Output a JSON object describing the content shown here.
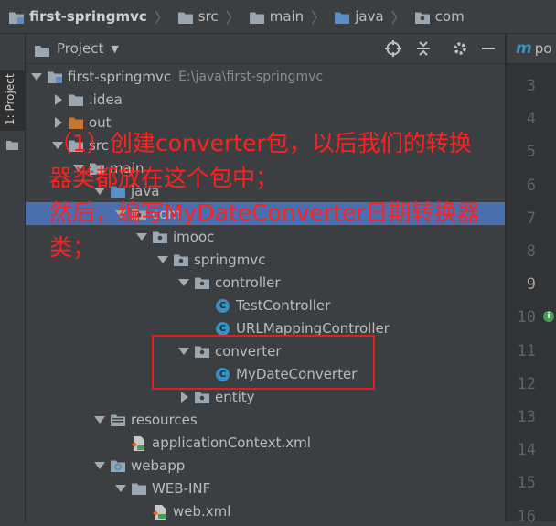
{
  "breadcrumb": [
    "first-springmvc",
    "src",
    "main",
    "java",
    "com"
  ],
  "tool_stripe": {
    "project_tab_label": "1: Project"
  },
  "panel": {
    "title": "Project",
    "caret": "▼"
  },
  "tree": [
    {
      "label": "first-springmvc",
      "path": "E:\\java\\first-springmvc",
      "icon": "module-folder-icon",
      "arrow": "down",
      "indent": 0
    },
    {
      "label": ".idea",
      "icon": "folder-icon",
      "arrow": "right",
      "indent": 1
    },
    {
      "label": "out",
      "icon": "orange-folder-icon",
      "arrow": "right",
      "indent": 1
    },
    {
      "label": "src",
      "icon": "folder-icon",
      "arrow": "down",
      "indent": 1
    },
    {
      "label": "main",
      "icon": "folder-icon",
      "arrow": "down",
      "indent": 2
    },
    {
      "label": "java",
      "icon": "blue-folder-icon",
      "arrow": "down",
      "indent": 3
    },
    {
      "label": "com",
      "icon": "package-icon",
      "arrow": "down",
      "indent": 4,
      "selected": true
    },
    {
      "label": "imooc",
      "icon": "package-icon",
      "arrow": "down",
      "indent": 5
    },
    {
      "label": "springmvc",
      "icon": "package-icon",
      "arrow": "down",
      "indent": 6
    },
    {
      "label": "controller",
      "icon": "package-icon",
      "arrow": "down",
      "indent": 7
    },
    {
      "label": "TestController",
      "icon": "class-icon",
      "arrow": "none",
      "indent": 8
    },
    {
      "label": "URLMappingController",
      "icon": "class-icon",
      "arrow": "none",
      "indent": 8
    },
    {
      "label": "converter",
      "icon": "package-icon",
      "arrow": "down",
      "indent": 7
    },
    {
      "label": "MyDateConverter",
      "icon": "class-icon",
      "arrow": "none",
      "indent": 8
    },
    {
      "label": "entity",
      "icon": "package-icon",
      "arrow": "right",
      "indent": 7
    },
    {
      "label": "resources",
      "icon": "resources-folder-icon",
      "arrow": "down",
      "indent": 3
    },
    {
      "label": "applicationContext.xml",
      "icon": "xml-file-icon",
      "arrow": "none",
      "indent": 4
    },
    {
      "label": "webapp",
      "icon": "web-folder-icon",
      "arrow": "down",
      "indent": 3
    },
    {
      "label": "WEB-INF",
      "icon": "folder-icon",
      "arrow": "down",
      "indent": 4
    },
    {
      "label": "web.xml",
      "icon": "xml-file-icon",
      "arrow": "none",
      "indent": 5
    }
  ],
  "editor": {
    "tab_icon": "m",
    "tab_label": "po",
    "line_numbers": [
      "3",
      "4",
      "5",
      "6",
      "7",
      "8",
      "9",
      "10",
      "11",
      "12",
      "13",
      "14",
      "15",
      "16"
    ],
    "active_line": "9"
  },
  "class_icon_letter": "C",
  "annotation": {
    "line1": "（1）创建converter包，以后我们的转换",
    "line2": "器类都放在这个包中；",
    "line3": "然后，编写MyDateConverter日期转换器",
    "line4": "类；"
  },
  "colors": {
    "background": "#3c3f41",
    "selection": "#4b6eaf",
    "annotation_text": "#ff2020",
    "highlight_box": "#e02020",
    "class_icon": "#3592c4"
  }
}
